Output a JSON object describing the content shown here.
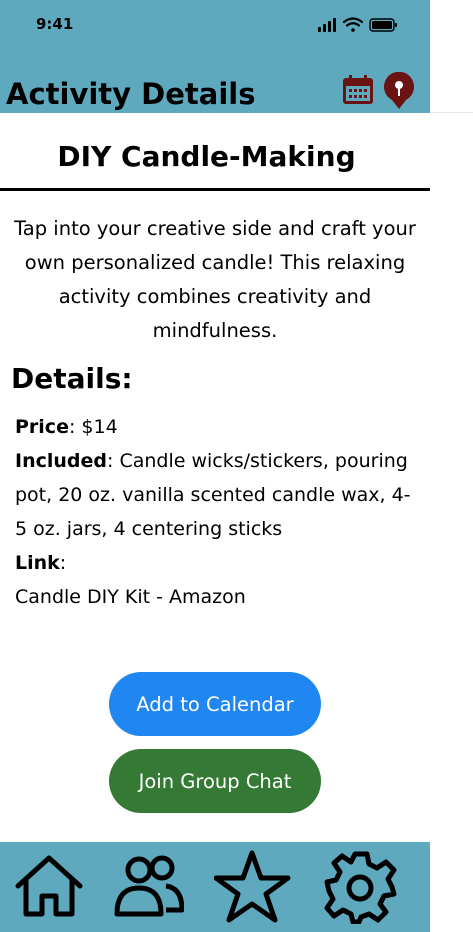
{
  "status_bar": {
    "time": "9:41"
  },
  "header": {
    "title": "Activity Details",
    "calendar_icon": "calendar-icon",
    "pin_icon": "map-pin-icon"
  },
  "activity": {
    "title": "DIY Candle-Making",
    "description": "Tap into your creative side and craft your own personalized candle! This relaxing activity combines creativity and mindfulness."
  },
  "details": {
    "heading": "Details:",
    "price_label": "Price",
    "price_value": ": $14",
    "included_label": "Included",
    "included_value": ": Candle wicks/stickers, pouring pot, 20 oz. vanilla scented candle wax, 4-5 oz. jars, 4 centering sticks",
    "link_label": "Link",
    "link_sep": ":",
    "link_value": "Candle DIY Kit - Amazon"
  },
  "actions": {
    "add_calendar": "Add to Calendar",
    "join_chat": "Join Group Chat"
  },
  "colors": {
    "header_bg": "#5ea9bd",
    "primary_button": "#1f86f2",
    "secondary_button": "#347a35",
    "icon_dark_red": "#6b1212"
  },
  "tabbar": {
    "items": [
      "home-icon",
      "people-icon",
      "star-icon",
      "settings-icon"
    ]
  }
}
